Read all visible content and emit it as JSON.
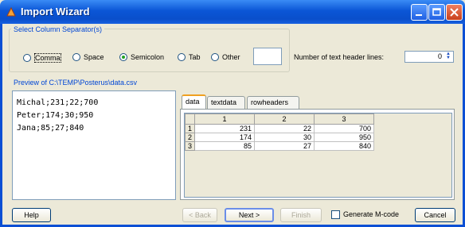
{
  "window": {
    "title": "Import Wizard"
  },
  "separator": {
    "legend": "Select Column Separator(s)",
    "options": [
      {
        "label": "Comma",
        "selected": false
      },
      {
        "label": "Space",
        "selected": false
      },
      {
        "label": "Semicolon",
        "selected": true
      },
      {
        "label": "Tab",
        "selected": false
      },
      {
        "label": "Other",
        "selected": false
      }
    ],
    "other_value": "",
    "header_lines_label": "Number of text header lines:",
    "header_lines_value": "0"
  },
  "preview": {
    "label": "Preview of C:\\TEMP\\Posterus\\data.csv",
    "lines": [
      "Michal;231;22;700",
      "Peter;174;30;950",
      "Jana;85;27;840"
    ]
  },
  "tabs": [
    "data",
    "textdata",
    "rowheaders"
  ],
  "active_tab": "data",
  "table": {
    "columns": [
      "1",
      "2",
      "3"
    ],
    "rows": [
      {
        "header": "1",
        "cells": [
          "231",
          "22",
          "700"
        ]
      },
      {
        "header": "2",
        "cells": [
          "174",
          "30",
          "950"
        ]
      },
      {
        "header": "3",
        "cells": [
          "85",
          "27",
          "840"
        ]
      }
    ]
  },
  "buttons": {
    "help": "Help",
    "back": "< Back",
    "next": "Next >",
    "finish": "Finish",
    "generate_mcode": "Generate M-code",
    "generate_mcode_checked": false,
    "cancel": "Cancel"
  }
}
